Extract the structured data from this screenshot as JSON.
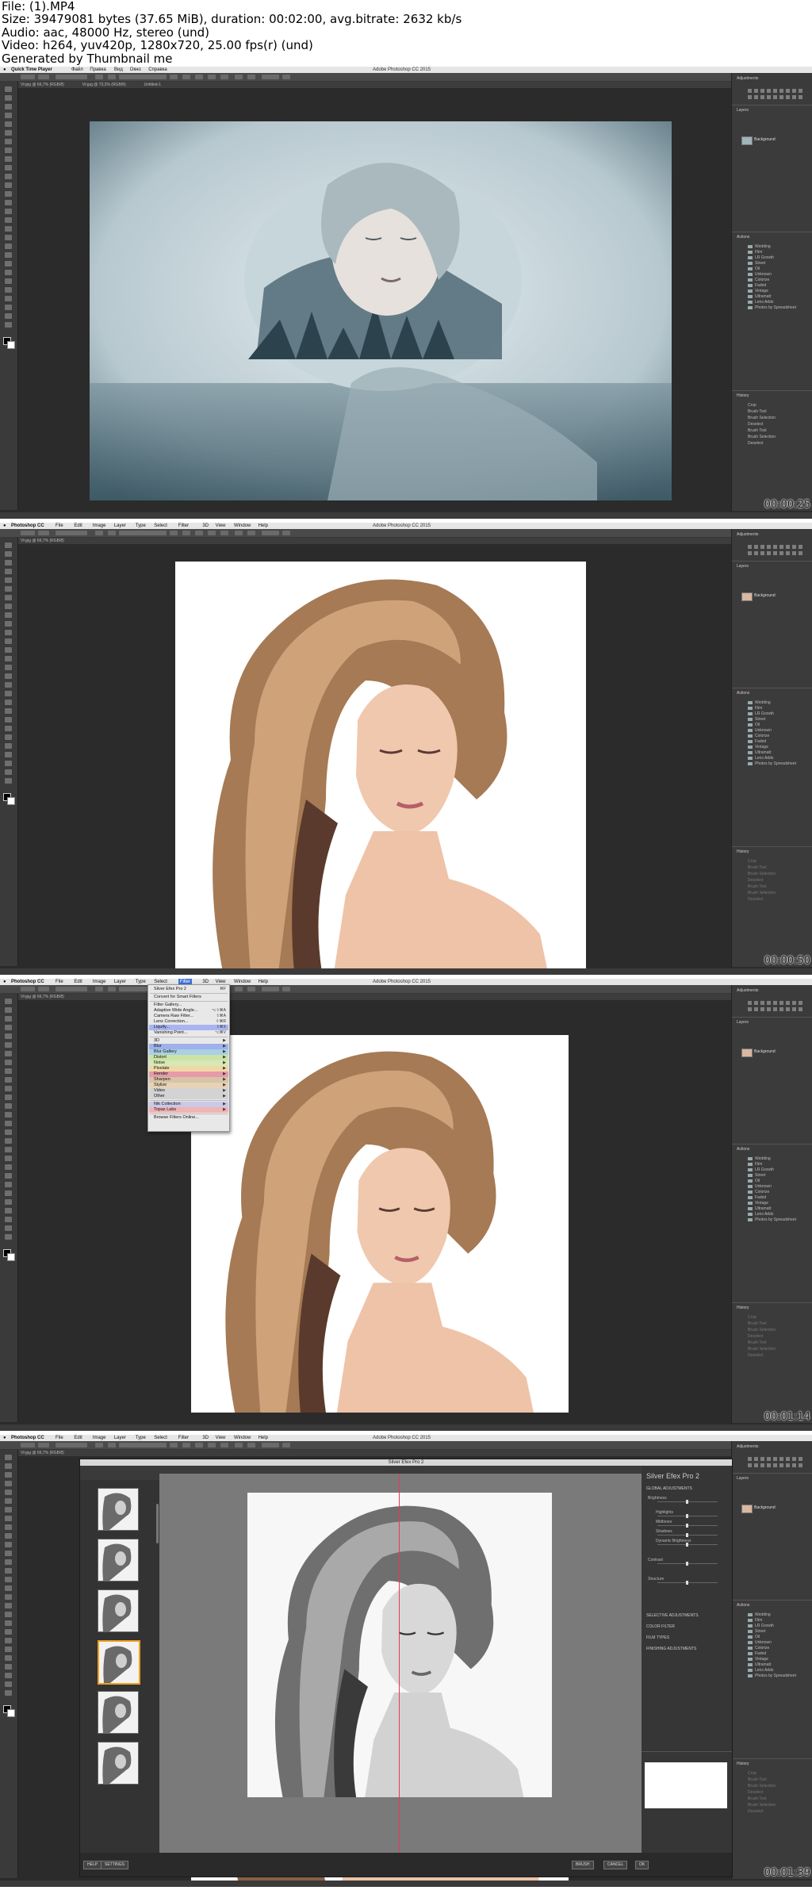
{
  "header": {
    "lines": [
      "File:  (1).MP4",
      "Size: 39479081 bytes (37.65 MiB), duration: 00:02:00, avg.bitrate: 2632 kb/s",
      "Audio: aac, 48000 Hz, stereo (und)",
      "Video: h264, yuv420p, 1280x720, 25.00 fps(r) (und)",
      "Generated by Thumbnail me"
    ]
  },
  "frames": [
    {
      "timestamp": "00:00:25",
      "app": "Quick Time Player",
      "menus": [
        "Файл",
        "Правка",
        "Вид",
        "Окно",
        "Справка"
      ],
      "window_title": "Adobe Photoshop CC 2015",
      "tabs": [
        "Vt-jpg @ 66,7% (RGB/8)",
        "Vt-jpg @ 73,3% (RGB/8)",
        "Untitled-1"
      ]
    },
    {
      "timestamp": "00:00:50",
      "app": "Photoshop CC",
      "menus": [
        "File",
        "Edit",
        "Image",
        "Layer",
        "Type",
        "Select",
        "Filter",
        "3D",
        "View",
        "Window",
        "Help"
      ],
      "window_title": "Adobe Photoshop CC 2015",
      "tabs": [
        "Vt-jpg @ 66,7% (RGB/8)"
      ]
    },
    {
      "timestamp": "00:01:14",
      "app": "Photoshop CC",
      "menus": [
        "File",
        "Edit",
        "Image",
        "Layer",
        "Type",
        "Select",
        "Filter",
        "3D",
        "View",
        "Window",
        "Help"
      ],
      "window_title": "Adobe Photoshop CC 2015",
      "tabs": [
        "Vt-jpg @ 66,7% (RGB/8)"
      ],
      "filter_menu": {
        "items": [
          {
            "label": "Silver Efex Pro 2",
            "shortcut": "⌘F"
          },
          {
            "label": "Convert for Smart Filters",
            "shortcut": ""
          },
          {
            "label": "Filter Gallery...",
            "shortcut": ""
          },
          {
            "label": "Adaptive Wide Angle...",
            "shortcut": "⌥⇧⌘A"
          },
          {
            "label": "Camera Raw Filter...",
            "shortcut": "⇧⌘A"
          },
          {
            "label": "Lens Correction...",
            "shortcut": "⇧⌘R"
          },
          {
            "label": "Liquify...",
            "shortcut": "⇧⌘X"
          },
          {
            "label": "Vanishing Point...",
            "shortcut": "⌥⌘V"
          },
          {
            "label": "3D",
            "shortcut": "▶"
          },
          {
            "label": "Blur",
            "shortcut": "▶"
          },
          {
            "label": "Blur Gallery",
            "shortcut": "▶"
          },
          {
            "label": "Distort",
            "shortcut": "▶"
          },
          {
            "label": "Noise",
            "shortcut": "▶"
          },
          {
            "label": "Pixelate",
            "shortcut": "▶"
          },
          {
            "label": "Render",
            "shortcut": "▶"
          },
          {
            "label": "Sharpen",
            "shortcut": "▶"
          },
          {
            "label": "Stylize",
            "shortcut": "▶"
          },
          {
            "label": "Video",
            "shortcut": "▶"
          },
          {
            "label": "Other",
            "shortcut": "▶"
          },
          {
            "label": "Nik Collection",
            "shortcut": "▶"
          },
          {
            "label": "Topaz Labs",
            "shortcut": "▶"
          },
          {
            "label": "Browse Filters Online...",
            "shortcut": ""
          }
        ]
      }
    },
    {
      "timestamp": "00:01:39",
      "app": "Photoshop CC",
      "menus": [
        "File",
        "Edit",
        "Image",
        "Layer",
        "Type",
        "Select",
        "Filter",
        "3D",
        "View",
        "Window",
        "Help"
      ],
      "window_title": "Adobe Photoshop CC 2015",
      "tabs": [
        "Vt-jpg @ 66,7% (RGB/8)"
      ],
      "plugin": {
        "title": "Silver Efex Pro 2",
        "brand": "Silver Efex Pro 2",
        "sections": [
          "GLOBAL ADJUSTMENTS",
          "SELECTIVE ADJUSTMENTS",
          "COLOR FILTER",
          "FILM TYPES",
          "FINISHING ADJUSTMENTS"
        ],
        "sliders": [
          "Brightness",
          "Highlights",
          "Midtones",
          "Shadows",
          "Dynamic Brightness",
          "Contrast",
          "Structure"
        ],
        "bottom_buttons": [
          "HELP",
          "SETTINGS",
          "BRUSH",
          "CANCEL",
          "OK"
        ]
      }
    }
  ],
  "panels": {
    "adjustments": "Adjustments",
    "layers": "Layers",
    "actions": "Actions",
    "history": "History",
    "layer_name": "Background",
    "action_folders": [
      "Wedding",
      "Film",
      "LR Growth",
      "Street",
      "Oil",
      "Unknown",
      "Colorize",
      "Faded",
      "Vintage",
      "Ultramatt",
      "Lens Adds",
      "Photos by Spreadsheet"
    ],
    "history_items": [
      "Crop",
      "Brush Tool",
      "Brush Selection",
      "Deselect",
      "Brush Tool",
      "Brush Selection",
      "Deselect"
    ]
  },
  "colors": {
    "ps_bg": "#2b2b2b",
    "panel_bg": "#3b3b3b",
    "menu_highlight": "#3f6fd6",
    "guide_red": "#e33b5e"
  }
}
